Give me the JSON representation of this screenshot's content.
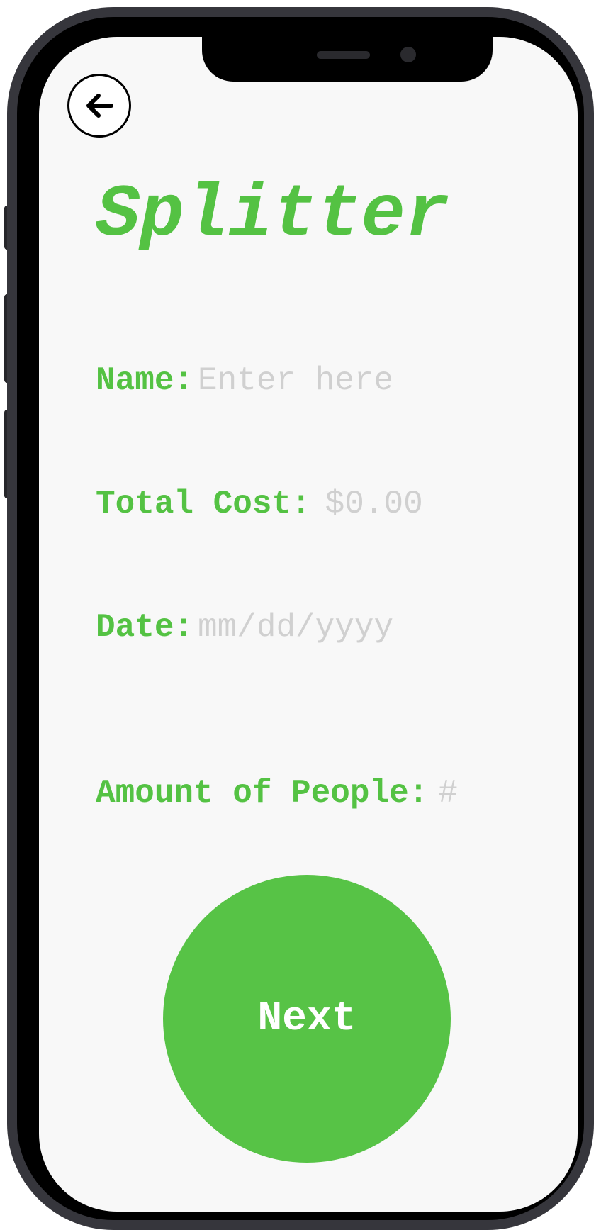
{
  "app": {
    "title": "Splitter",
    "accent_color": "#54c243"
  },
  "header": {
    "back_icon": "arrow-left-icon"
  },
  "form": {
    "name": {
      "label": "Name:",
      "placeholder": "Enter here",
      "value": ""
    },
    "total_cost": {
      "label": "Total Cost:",
      "placeholder": "$0.00",
      "value": ""
    },
    "date": {
      "label": "Date:",
      "placeholder": "mm/dd/yyyy",
      "value": ""
    },
    "people": {
      "label": "Amount of People:",
      "placeholder": "#",
      "value": ""
    }
  },
  "actions": {
    "next_label": "Next"
  }
}
